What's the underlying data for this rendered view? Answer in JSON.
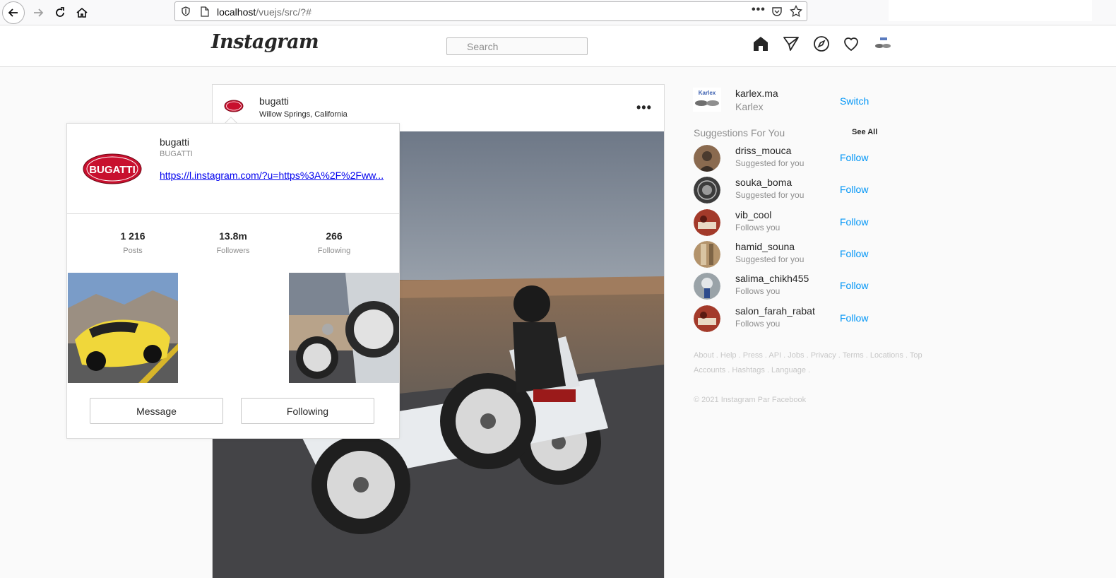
{
  "browser": {
    "url_host": "localhost",
    "url_path": "/vuejs/src/?#",
    "more_label": "•••"
  },
  "header": {
    "logo": "Instagram",
    "search_placeholder": "Search"
  },
  "post": {
    "username": "bugatti",
    "location": "Willow Springs, California",
    "more_label": "•••"
  },
  "hover_card": {
    "username": "bugatti",
    "full_name": "BUGATTI",
    "logo_text": "BUGATTI",
    "link": "https://l.instagram.com/?u=https%3A%2F%2Fww...",
    "stats": [
      {
        "value": "1 216",
        "label": "Posts"
      },
      {
        "value": "13.8m",
        "label": "Followers"
      },
      {
        "value": "266",
        "label": "Following"
      }
    ],
    "message_label": "Message",
    "following_label": "Following"
  },
  "sidebar": {
    "me": {
      "username": "karlex.ma",
      "name": "Karlex",
      "switch_label": "Switch",
      "avatar_text": "Karlex"
    },
    "suggestions_title": "Suggestions For You",
    "see_all_label": "See All",
    "suggestions": [
      {
        "username": "driss_mouca",
        "sub": "Suggested for you",
        "follow": "Follow",
        "color": "#8a6a4f"
      },
      {
        "username": "souka_boma",
        "sub": "Suggested for you",
        "follow": "Follow",
        "color": "#3c3c3c"
      },
      {
        "username": "vib_cool",
        "sub": "Follows you",
        "follow": "Follow",
        "color": "#a33a2a"
      },
      {
        "username": "hamid_souna",
        "sub": "Suggested for you",
        "follow": "Follow",
        "color": "#b3936b"
      },
      {
        "username": "salima_chikh455",
        "sub": "Follows you",
        "follow": "Follow",
        "color": "#9aa3a8"
      },
      {
        "username": "salon_farah_rabat",
        "sub": "Follows you",
        "follow": "Follow",
        "color": "#a33a2a"
      }
    ],
    "footer_links": "About . Help . Press . API . Jobs . Privacy . Terms . Locations . Top Accounts . Hashtags . Language .",
    "copyright": "© 2021 Instagram Par Facebook"
  },
  "colors": {
    "accent_blue": "#0095f6",
    "link_blue": "#0000ee",
    "bugatti_red": "#c8102e"
  }
}
